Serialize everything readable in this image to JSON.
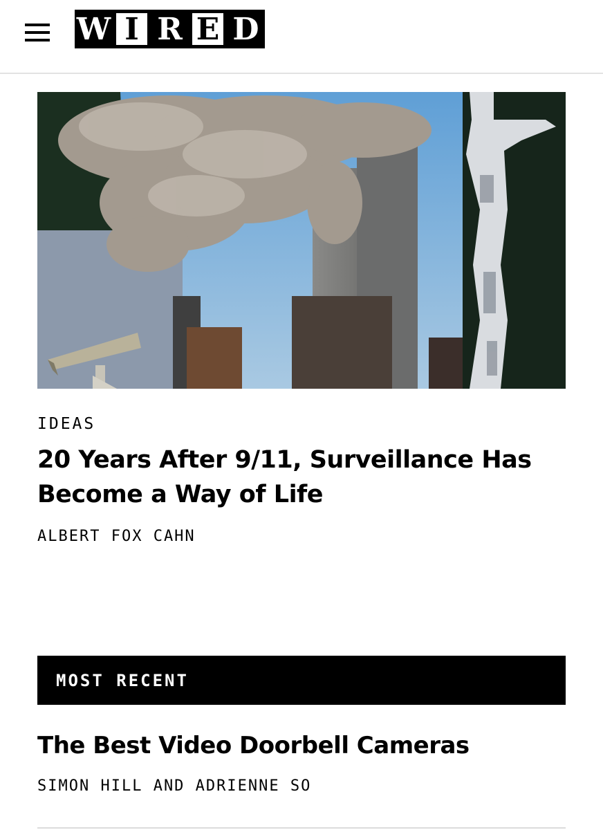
{
  "header": {
    "menu_icon": "hamburger-menu-icon",
    "logo_letters": [
      "W",
      "I",
      "R",
      "E",
      "D"
    ]
  },
  "hero_image": {
    "description_icon": "hero-collage-image",
    "colors": {
      "sky": "#7fb1d9",
      "smoke": "#a8a096",
      "tower": "#6e6e6e",
      "dark": "#1b2a1c"
    }
  },
  "article": {
    "kicker": "IDEAS",
    "headline": "20 Years After 9/11, Surveillance Has Become a Way of Life",
    "byline": "ALBERT FOX CAHN"
  },
  "most_recent": {
    "label": "MOST RECENT",
    "items": [
      {
        "title": "The Best Video Doorbell Cameras",
        "byline": "SIMON HILL AND ADRIENNE SO"
      }
    ]
  }
}
